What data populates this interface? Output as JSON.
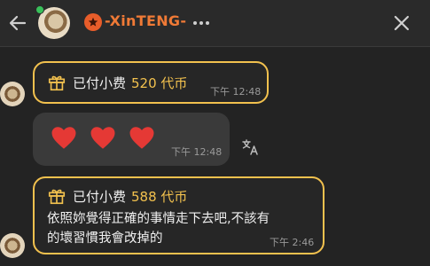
{
  "header": {
    "back_icon": "arrow-left-icon",
    "title": "-XinTENG-",
    "more_icon": "more-horizontal-icon",
    "close_icon": "close-icon",
    "badge_icon": "star-badge-icon"
  },
  "messages": [
    {
      "type": "tip",
      "tip_label": "已付小费",
      "tip_amount": "520 代币",
      "time": "下午 12:48"
    },
    {
      "type": "hearts",
      "hearts": [
        "❤️",
        "❤️",
        "❤️"
      ],
      "time": "下午 12:48",
      "translate_icon": "translate-icon"
    },
    {
      "type": "tip",
      "tip_label": "已付小费",
      "tip_amount": "588 代币",
      "text_line1": "依照妳覺得正確的事情走下去吧,不該有",
      "text_line2": "的壞習慣我會改掉的",
      "time": "下午 2:46"
    }
  ],
  "colors": {
    "background": "#232323",
    "accent_gold": "#f2c14e",
    "title_orange": "#f07a36",
    "heart_red": "#e53935"
  }
}
